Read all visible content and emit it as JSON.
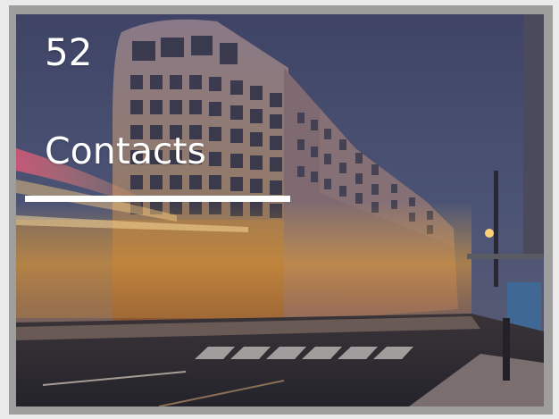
{
  "tile": {
    "count": "52",
    "title": "Contacts"
  },
  "colors": {
    "frame": "#9e9e9c",
    "text": "#ffffff",
    "underline": "#ffffff"
  }
}
